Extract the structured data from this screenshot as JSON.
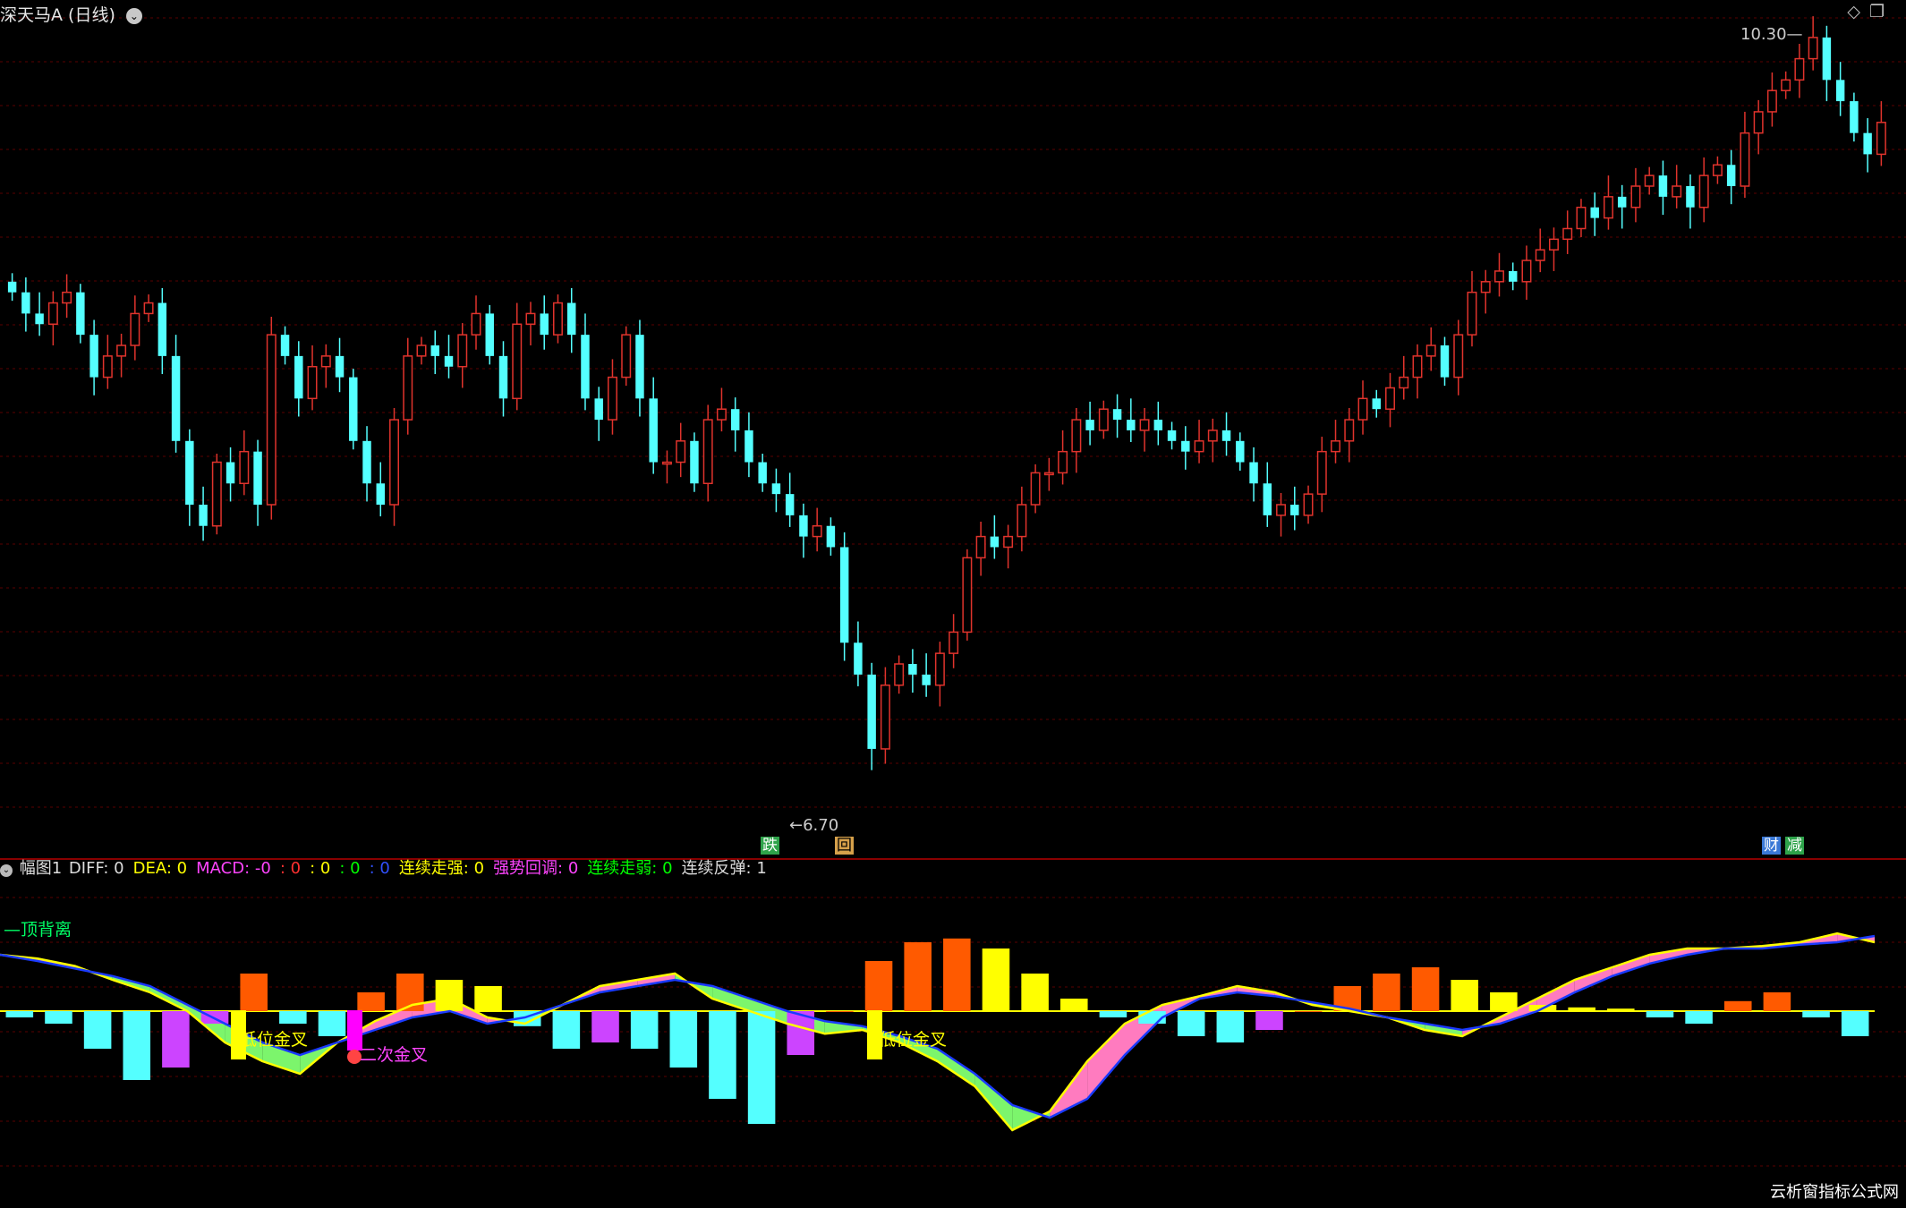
{
  "window": {
    "title": "深天马A",
    "period": "(日线)",
    "icons": [
      "diamond-icon",
      "window-restore-icon"
    ]
  },
  "colors": {
    "background": "#000000",
    "up": "#e0332c",
    "down": "#54ffff",
    "grid": "#5a0000",
    "diff_line": "#ffff00",
    "dea_line": "#1a3aff",
    "hist_pos_strong": "#ff5a00",
    "hist_pos_weak": "#ffff00",
    "hist_neg_strong": "#54ffff",
    "hist_neg_weak": "#cc44ff",
    "fill_bull": "#ff7bbf",
    "fill_bear": "#7cf56c"
  },
  "price_annotations": {
    "high_label": "10.30",
    "low_label": "6.70",
    "event_markers": [
      {
        "text": "跌",
        "color": "#2ea34a"
      },
      {
        "text": "回",
        "color": "#d6a04a"
      },
      {
        "text": "财",
        "color": "#3a78d6"
      },
      {
        "text": "减",
        "color": "#2ea34a"
      }
    ]
  },
  "indicator": {
    "name": "幅图1",
    "fields": [
      {
        "label": "DIFF: 0",
        "color": "#dddddd"
      },
      {
        "label": "DEA: 0",
        "color": "#ffff00"
      },
      {
        "label": "MACD: -0",
        "color": "#ff44ff"
      },
      {
        "label": ": 0",
        "color": "#ff3030"
      },
      {
        "label": ": 0",
        "color": "#ffff00"
      },
      {
        "label": ": 0",
        "color": "#00ff00"
      },
      {
        "label": ": 0",
        "color": "#3050ff"
      },
      {
        "label": "连续走强: 0",
        "color": "#ffff00"
      },
      {
        "label": "强势回调: 0",
        "color": "#ff44ff"
      },
      {
        "label": "连续走弱: 0",
        "color": "#00ff00"
      },
      {
        "label": "连续反弹: 1",
        "color": "#dddddd"
      }
    ]
  },
  "macd_annotations": {
    "divergence": "顶背离",
    "low_cross_1": "低位金叉",
    "second_cross": "二次金叉",
    "low_cross_2": "低位金叉"
  },
  "watermark": "云析窗指标公式网",
  "chart_data": [
    {
      "type": "candlestick",
      "title": "深天马A (日线)",
      "xlabel": "",
      "ylabel": "",
      "ylim": [
        6.6,
        10.35
      ],
      "grid": true,
      "high": 10.3,
      "low": 6.7,
      "note_values": "approximate per-candle close path (open ~ previous close)",
      "close": [
        9.1,
        9.0,
        8.95,
        9.05,
        9.1,
        8.9,
        8.7,
        8.8,
        8.85,
        9.0,
        9.05,
        8.8,
        8.4,
        8.1,
        8.0,
        8.3,
        8.2,
        8.35,
        8.1,
        8.9,
        8.8,
        8.6,
        8.75,
        8.8,
        8.7,
        8.4,
        8.2,
        8.1,
        8.5,
        8.8,
        8.85,
        8.8,
        8.75,
        8.9,
        9.0,
        8.8,
        8.6,
        8.95,
        9.0,
        8.9,
        9.05,
        8.9,
        8.6,
        8.5,
        8.7,
        8.9,
        8.6,
        8.3,
        8.3,
        8.4,
        8.2,
        8.5,
        8.55,
        8.45,
        8.3,
        8.2,
        8.15,
        8.05,
        7.95,
        8.0,
        7.9,
        7.45,
        7.3,
        6.95,
        7.25,
        7.35,
        7.3,
        7.25,
        7.4,
        7.5,
        7.85,
        7.95,
        7.9,
        7.95,
        8.1,
        8.25,
        8.25,
        8.35,
        8.5,
        8.45,
        8.55,
        8.5,
        8.45,
        8.5,
        8.45,
        8.4,
        8.35,
        8.4,
        8.45,
        8.4,
        8.3,
        8.2,
        8.05,
        8.1,
        8.05,
        8.15,
        8.35,
        8.4,
        8.5,
        8.6,
        8.55,
        8.65,
        8.7,
        8.8,
        8.85,
        8.7,
        8.9,
        9.1,
        9.15,
        9.2,
        9.15,
        9.25,
        9.3,
        9.35,
        9.4,
        9.5,
        9.45,
        9.55,
        9.5,
        9.6,
        9.65,
        9.55,
        9.6,
        9.5,
        9.65,
        9.7,
        9.6,
        9.85,
        9.95,
        10.05,
        10.1,
        10.2,
        10.3,
        10.1,
        10.0,
        9.85,
        9.75,
        9.9
      ]
    },
    {
      "type": "bar",
      "title": "幅图1",
      "xlabel": "",
      "ylabel": "",
      "ylim": [
        -1,
        1
      ],
      "grid": true,
      "series": [
        {
          "name": "DIFF",
          "values": [
            0.45,
            0.42,
            0.36,
            0.25,
            0.15,
            0.0,
            -0.25,
            -0.4,
            -0.5,
            -0.25,
            -0.08,
            0.05,
            0.1,
            -0.05,
            -0.1,
            0.05,
            0.2,
            0.25,
            0.3,
            0.1,
            0.0,
            -0.1,
            -0.18,
            -0.15,
            -0.25,
            -0.4,
            -0.6,
            -0.95,
            -0.8,
            -0.4,
            -0.1,
            0.05,
            0.12,
            0.2,
            0.15,
            0.05,
            0.0,
            -0.05,
            -0.15,
            -0.2,
            -0.05,
            0.1,
            0.25,
            0.35,
            0.45,
            0.5,
            0.5,
            0.52,
            0.55,
            0.62,
            0.55
          ]
        },
        {
          "name": "DEA",
          "values": [
            0.45,
            0.4,
            0.34,
            0.28,
            0.2,
            0.05,
            -0.1,
            -0.25,
            -0.35,
            -0.25,
            -0.15,
            -0.05,
            0.0,
            -0.1,
            -0.05,
            0.05,
            0.15,
            0.2,
            0.25,
            0.2,
            0.1,
            0.0,
            -0.08,
            -0.12,
            -0.2,
            -0.3,
            -0.5,
            -0.75,
            -0.85,
            -0.7,
            -0.35,
            -0.05,
            0.1,
            0.15,
            0.12,
            0.07,
            0.02,
            -0.05,
            -0.1,
            -0.15,
            -0.1,
            0.0,
            0.15,
            0.28,
            0.38,
            0.45,
            0.5,
            0.5,
            0.53,
            0.55,
            0.6
          ]
        },
        {
          "name": "MACD",
          "values": [
            -0.05,
            -0.1,
            -0.3,
            -0.55,
            -0.45,
            -0.1,
            0.3,
            -0.1,
            -0.2,
            0.15,
            0.3,
            0.25,
            0.2,
            -0.12,
            -0.3,
            -0.25,
            -0.3,
            -0.45,
            -0.7,
            -0.9,
            -0.35,
            0.0,
            0.4,
            0.55,
            0.58,
            0.5,
            0.3,
            0.1,
            -0.05,
            -0.1,
            -0.2,
            -0.25,
            -0.15,
            0.0,
            0.2,
            0.3,
            0.35,
            0.25,
            0.15,
            0.05,
            0.03,
            0.02,
            -0.05,
            -0.1,
            0.08,
            0.15,
            -0.05,
            -0.2
          ]
        }
      ]
    }
  ]
}
